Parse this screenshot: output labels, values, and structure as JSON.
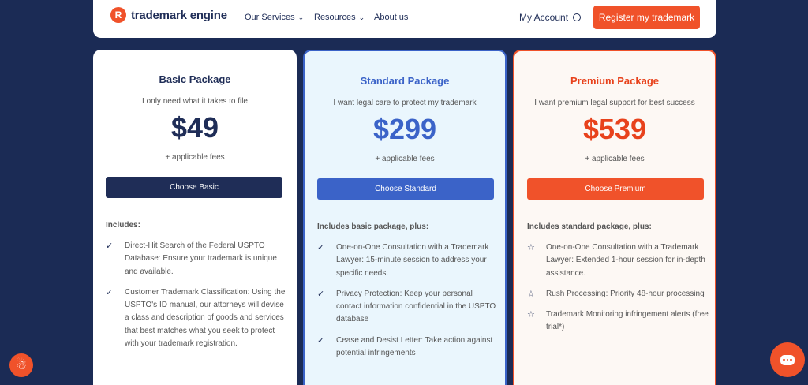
{
  "header": {
    "logo_text": "trademark engine",
    "nav": [
      {
        "label": "Our Services"
      },
      {
        "label": "Resources"
      },
      {
        "label": "About us"
      }
    ],
    "account_label": "My Account",
    "register_label": "Register my trademark"
  },
  "packages": [
    {
      "title": "Basic Package",
      "subtitle": "I only need what it takes to file",
      "price": "$49",
      "fees": "+ applicable fees",
      "button": "Choose Basic",
      "includes": "Includes:",
      "features": [
        "Direct-Hit Search of the Federal USPTO Database: Ensure your trademark is unique and available.",
        "Customer Trademark Classification: Using the USPTO's ID manual, our attorneys will devise a class and description of goods and services that best matches what you seek to protect with your trademark registration."
      ],
      "icon": "check-icon"
    },
    {
      "title": "Standard Package",
      "subtitle": "I want legal care to protect my trademark",
      "price": "$299",
      "fees": "+ applicable fees",
      "button": "Choose Standard",
      "includes": "Includes basic package, plus:",
      "features": [
        "One-on-One Consultation with a Trademark Lawyer: 15-minute session to address your specific needs.",
        "Privacy Protection: Keep your personal contact information confidential in the USPTO database",
        "Cease and Desist Letter: Take action against potential infringements"
      ],
      "icon": "check-icon"
    },
    {
      "title": "Premium Package",
      "subtitle": "I want premium legal support for best success",
      "price": "$539",
      "fees": "+ applicable fees",
      "button": "Choose Premium",
      "includes": "Includes standard package, plus:",
      "features": [
        "One-on-One Consultation with a Trademark Lawyer: Extended 1-hour session for in-depth assistance.",
        "Rush Processing: Priority 48-hour processing",
        "Trademark Monitoring infringement alerts (free trial*)"
      ],
      "icon": "star-icon"
    }
  ],
  "colors": {
    "background": "#1b2b55",
    "brand_orange": "#f0522a",
    "basic_navy": "#1f2d57",
    "standard_blue": "#3b63c8",
    "premium_red": "#e8421c"
  },
  "widgets": {
    "accessibility_icon": "accessibility-icon",
    "chat_icon": "chat-icon"
  }
}
